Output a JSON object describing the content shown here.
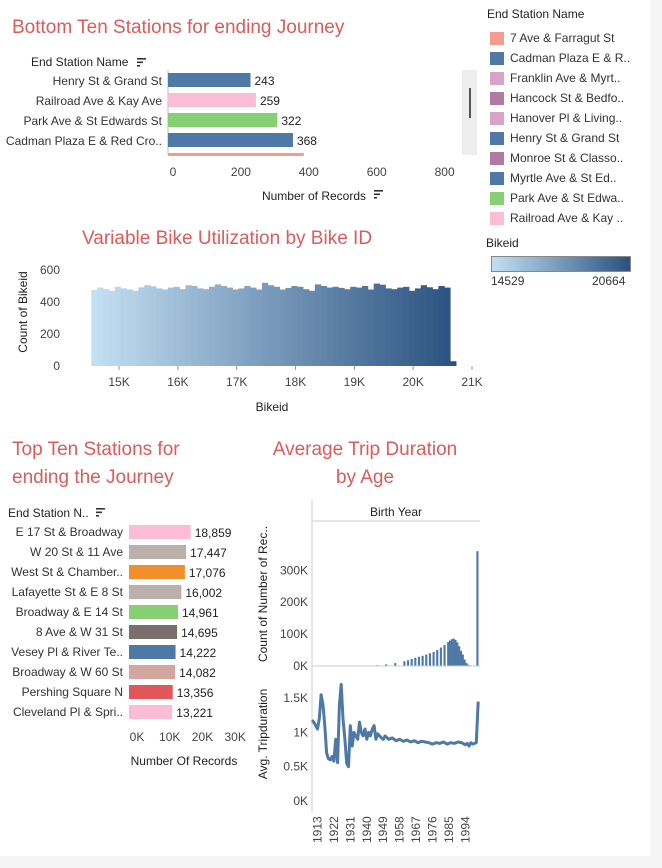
{
  "titles": {
    "bottom_ten": "Bottom Ten Stations for ending Journey",
    "variable_bike": "Variable Bike Utilization by Bike ID",
    "top_ten_line1": "Top Ten Stations for",
    "top_ten_line2": "ending the Journey",
    "avg_trip_line1": "Average Trip Duration",
    "avg_trip_line2": "by Age"
  },
  "legend": {
    "title": "End Station Name",
    "items": [
      {
        "label": "7 Ave & Farragut St",
        "color": "#f79a8f"
      },
      {
        "label": "Cadman Plaza E & R..",
        "color": "#4e79a7"
      },
      {
        "label": "Franklin Ave & Myrt..",
        "color": "#d7a4c8"
      },
      {
        "label": "Hancock St & Bedfo..",
        "color": "#b07aa1"
      },
      {
        "label": "Hanover Pl & Living..",
        "color": "#d7a4c8"
      },
      {
        "label": "Henry St & Grand St",
        "color": "#4e79a7"
      },
      {
        "label": "Monroe St & Classo..",
        "color": "#b07aa1"
      },
      {
        "label": "Myrtle Ave & St Ed..",
        "color": "#4e79a7"
      },
      {
        "label": "Park Ave & St Edwa..",
        "color": "#86cf73"
      },
      {
        "label": "Railroad Ave & Kay ..",
        "color": "#fbbdd3"
      }
    ],
    "gradient_title": "Bikeid",
    "gradient_min": "14529",
    "gradient_max": "20664",
    "gradient_low_color": "#c3dff2",
    "gradient_high_color": "#2a5180"
  },
  "chart_data": [
    {
      "type": "bar",
      "orientation": "horizontal",
      "title": "Bottom Ten Stations for ending Journey",
      "row_header": "End Station Name",
      "xlabel": "Number of Records",
      "categories": [
        "Henry St & Grand St",
        "Railroad Ave & Kay Ave",
        "Park Ave & St Edwards St",
        "Cadman Plaza E & Red Cro.."
      ],
      "values": [
        243,
        259,
        322,
        368
      ],
      "value_labels": [
        "243",
        "259",
        "322",
        "368"
      ],
      "colors": [
        "#4e79a7",
        "#fbbdd3",
        "#86cf73",
        "#4e79a7"
      ],
      "xlim": [
        0,
        860
      ],
      "xticks": [
        0,
        200,
        400,
        600,
        800
      ],
      "xtick_labels": [
        "0",
        "200",
        "400",
        "600",
        "800"
      ]
    },
    {
      "type": "bar",
      "title": "Variable Bike Utilization by Bike ID",
      "xlabel": "Bikeid",
      "ylabel": "Count of Bikeid",
      "xlim": [
        14200,
        21000
      ],
      "ylim": [
        0,
        600
      ],
      "xticks": [
        15000,
        16000,
        17000,
        18000,
        19000,
        20000,
        21000
      ],
      "xtick_labels": [
        "15K",
        "16K",
        "17K",
        "18K",
        "19K",
        "20K",
        "21K"
      ],
      "yticks": [
        0,
        200,
        400,
        600
      ],
      "ytick_labels": [
        "0",
        "200",
        "400",
        "600"
      ],
      "bin_width": 100,
      "x": [
        14529,
        14629,
        14729,
        14829,
        14929,
        15029,
        15129,
        15229,
        15329,
        15429,
        15529,
        15629,
        15729,
        15829,
        15929,
        16029,
        16129,
        16229,
        16329,
        16429,
        16529,
        16629,
        16729,
        16829,
        16929,
        17029,
        17129,
        17229,
        17329,
        17429,
        17529,
        17629,
        17729,
        17829,
        17929,
        18029,
        18129,
        18229,
        18329,
        18429,
        18529,
        18629,
        18729,
        18829,
        18929,
        19029,
        19129,
        19229,
        19329,
        19429,
        19529,
        19629,
        19729,
        19829,
        19929,
        20029,
        20129,
        20229,
        20329,
        20429,
        20529,
        20629
      ],
      "values": [
        475,
        490,
        480,
        470,
        495,
        485,
        478,
        470,
        492,
        505,
        498,
        485,
        478,
        490,
        495,
        480,
        505,
        500,
        485,
        480,
        495,
        510,
        500,
        490,
        478,
        485,
        500,
        490,
        478,
        520,
        505,
        495,
        478,
        488,
        500,
        495,
        480,
        470,
        510,
        500,
        490,
        495,
        488,
        480,
        495,
        490,
        500,
        478,
        515,
        508,
        485,
        480,
        490,
        495,
        470,
        485,
        505,
        492,
        480,
        500,
        490,
        30
      ]
    },
    {
      "type": "bar",
      "orientation": "horizontal",
      "title": "Top Ten Stations for ending the Journey",
      "row_header": "End Station N..",
      "xlabel": "Number Of Records",
      "categories": [
        "E 17 St & Broadway",
        "W 20 St & 11 Ave",
        "West St & Chamber..",
        "Lafayette St & E 8 St",
        "Broadway & E 14 St",
        "8 Ave & W 31 St",
        "Vesey Pl & River Te..",
        "Broadway & W 60 St",
        "Pershing Square N",
        "Cleveland Pl & Spri.."
      ],
      "values": [
        18859,
        17447,
        17076,
        16002,
        14961,
        14695,
        14222,
        14082,
        13356,
        13221
      ],
      "value_labels": [
        "18,859",
        "17,447",
        "17,076",
        "16,002",
        "14,961",
        "14,695",
        "14,222",
        "14,082",
        "13,356",
        "13,221"
      ],
      "colors": [
        "#fbbdd3",
        "#bab0ac",
        "#f28e2b",
        "#bab0ac",
        "#86cf73",
        "#79706e",
        "#4e79a7",
        "#d4a6a0",
        "#e15759",
        "#fbbdd3"
      ],
      "xlim": [
        0,
        33000
      ],
      "xticks": [
        0,
        10000,
        20000,
        30000
      ],
      "xtick_labels": [
        "0K",
        "10K",
        "20K",
        "30K"
      ]
    },
    {
      "type": "bar",
      "title": "Average Trip Duration by Age",
      "column_header": "Birth Year",
      "ylabel": "Count of Number of Rec..",
      "xlim": [
        1910,
        2002
      ],
      "ylim": [
        0,
        370000
      ],
      "yticks": [
        0,
        100000,
        200000,
        300000
      ],
      "ytick_labels": [
        "0K",
        "100K",
        "200K",
        "300K"
      ],
      "x": [
        1930,
        1935,
        1940,
        1945,
        1950,
        1955,
        1960,
        1962,
        1964,
        1966,
        1968,
        1970,
        1972,
        1974,
        1976,
        1978,
        1980,
        1982,
        1984,
        1985,
        1986,
        1987,
        1988,
        1989,
        1990,
        1991,
        1992,
        1993,
        1994,
        1995,
        1996,
        1997,
        1998,
        1999,
        2000
      ],
      "values": [
        200,
        500,
        1200,
        2500,
        5000,
        9000,
        15000,
        18000,
        22000,
        26000,
        29000,
        32000,
        36000,
        40000,
        44000,
        50000,
        58000,
        66000,
        75000,
        80000,
        84000,
        86000,
        82000,
        74000,
        62000,
        48000,
        36000,
        20000,
        9000,
        4000,
        2000,
        1000,
        500,
        300,
        360000
      ]
    },
    {
      "type": "line",
      "ylabel": "Avg. Tripduration",
      "xlim": [
        1910,
        2002
      ],
      "ylim": [
        0,
        1750
      ],
      "yticks": [
        0,
        500,
        1000,
        1500
      ],
      "ytick_labels": [
        "0K",
        "0.5K",
        "1K",
        "1.5K"
      ],
      "xticks": [
        1913,
        1922,
        1931,
        1940,
        1949,
        1958,
        1967,
        1976,
        1985,
        1994
      ],
      "xtick_labels": [
        "1913",
        "1922",
        "1931",
        "1940",
        "1949",
        "1958",
        "1967",
        "1976",
        "1985",
        "1994"
      ],
      "color": "#4e79a7",
      "x": [
        1910,
        1911,
        1912,
        1913,
        1914,
        1915,
        1916,
        1917,
        1918,
        1919,
        1920,
        1921,
        1922,
        1923,
        1924,
        1925,
        1926,
        1927,
        1928,
        1929,
        1930,
        1931,
        1932,
        1933,
        1934,
        1935,
        1936,
        1937,
        1938,
        1939,
        1940,
        1941,
        1942,
        1943,
        1944,
        1945,
        1946,
        1947,
        1948,
        1949,
        1950,
        1952,
        1954,
        1956,
        1958,
        1960,
        1962,
        1964,
        1966,
        1968,
        1970,
        1972,
        1974,
        1976,
        1978,
        1980,
        1982,
        1984,
        1986,
        1988,
        1990,
        1992,
        1994,
        1995,
        1996,
        1997,
        1998,
        1999,
        2000,
        2001
      ],
      "values": [
        1180,
        1150,
        1100,
        1050,
        1200,
        1550,
        1400,
        1100,
        700,
        620,
        600,
        650,
        580,
        900,
        560,
        1400,
        1700,
        1200,
        900,
        550,
        500,
        1100,
        800,
        1000,
        950,
        900,
        1150,
        1000,
        950,
        1050,
        900,
        1000,
        950,
        1050,
        1100,
        900,
        980,
        950,
        920,
        900,
        950,
        900,
        920,
        880,
        900,
        870,
        890,
        860,
        880,
        850,
        870,
        860,
        850,
        830,
        850,
        840,
        860,
        830,
        850,
        840,
        860,
        850,
        820,
        840,
        800,
        850,
        830,
        840,
        850,
        1450
      ]
    }
  ]
}
